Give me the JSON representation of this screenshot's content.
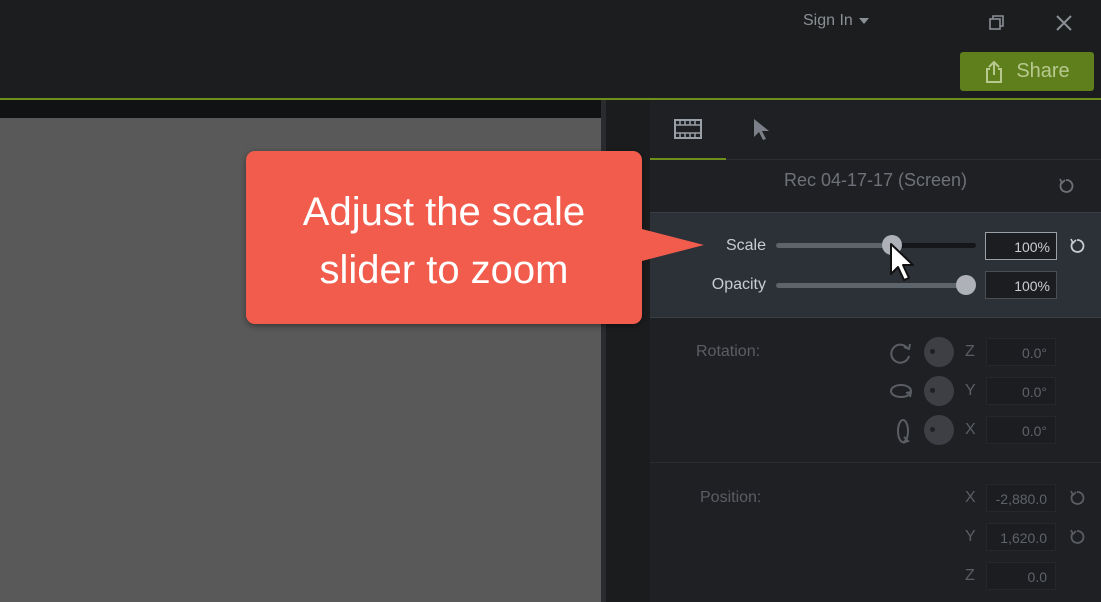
{
  "window": {
    "signin_label": "Sign In",
    "share_label": "Share",
    "accent_color": "#6f8f1d"
  },
  "properties": {
    "clip_title": "Rec 04-17-17 (Screen)",
    "scale": {
      "label": "Scale",
      "value": "100%",
      "slider_level": 0.58
    },
    "opacity": {
      "label": "Opacity",
      "value": "100%",
      "slider_level": 0.95
    },
    "rotation": {
      "label": "Rotation:",
      "z": {
        "axis": "Z",
        "value": "0.0°"
      },
      "y": {
        "axis": "Y",
        "value": "0.0°"
      },
      "x": {
        "axis": "X",
        "value": "0.0°"
      }
    },
    "position": {
      "label": "Position:",
      "x": {
        "axis": "X",
        "value": "-2,880.0"
      },
      "y": {
        "axis": "Y",
        "value": "1,620.0"
      },
      "z": {
        "axis": "Z",
        "value": "0.0"
      }
    }
  },
  "callout": {
    "line1": "Adjust the scale",
    "line2": "slider to zoom",
    "color": "#f15c4d"
  }
}
